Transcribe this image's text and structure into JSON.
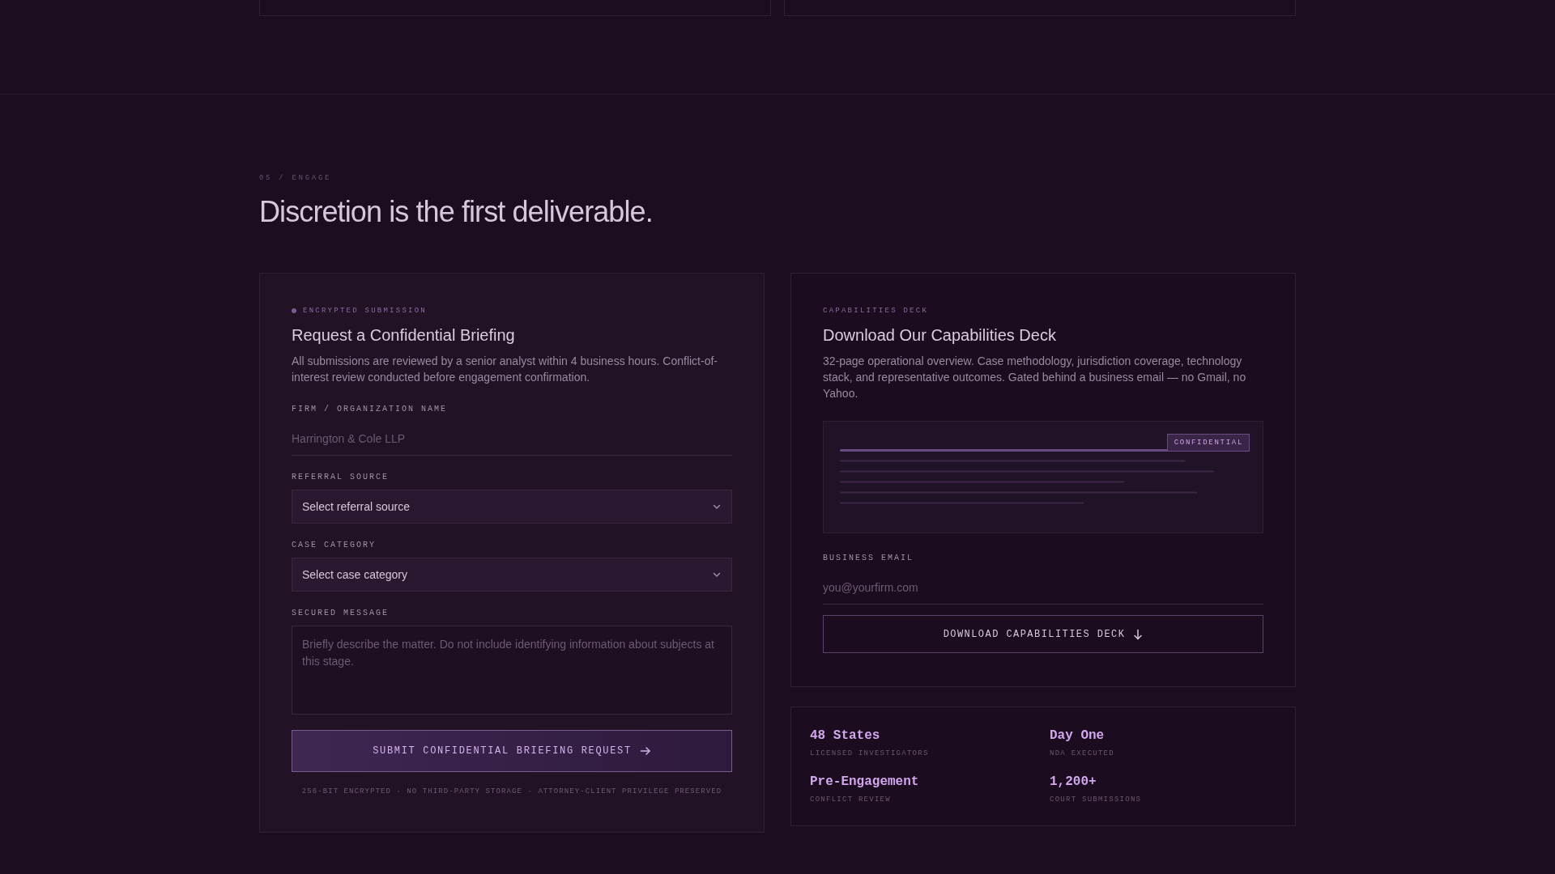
{
  "section": {
    "eyebrow": "05 / ENGAGE",
    "heading": "Discretion is the first deliverable."
  },
  "briefing_form": {
    "eyebrow": "ENCRYPTED SUBMISSION",
    "title": "Request a Confidential Briefing",
    "description": "All submissions are reviewed by a senior analyst within 4 business hours. Conflict-of-interest review conducted before engagement confirmation.",
    "fields": [
      {
        "kind": "text",
        "label": "FIRM / ORGANIZATION NAME",
        "placeholder": "Harrington & Cole LLP"
      },
      {
        "kind": "select",
        "label": "REFERRAL SOURCE",
        "value": "Select referral source"
      },
      {
        "kind": "select",
        "label": "CASE CATEGORY",
        "value": "Select case category"
      },
      {
        "kind": "textarea",
        "label": "SECURED MESSAGE",
        "placeholder": "Briefly describe the matter. Do not include identifying information about subjects at this stage."
      }
    ],
    "submit_button": "SUBMIT CONFIDENTIAL BRIEFING REQUEST",
    "footnote": "256-BIT ENCRYPTED · NO THIRD-PARTY STORAGE · ATTORNEY-CLIENT PRIVILEGE PRESERVED"
  },
  "capabilities_deck": {
    "eyebrow": "CAPABILITIES DECK",
    "title": "Download Our Capabilities Deck",
    "description": "32-page operational overview. Case methodology, jurisdiction coverage, technology stack, and representative outcomes. Gated behind a business email — no Gmail, no Yahoo.",
    "preview_badge": "CONFIDENTIAL",
    "email_field": {
      "label": "BUSINESS EMAIL",
      "placeholder": "you@yourfirm.com"
    },
    "download_button": "DOWNLOAD CAPABILITIES DECK"
  },
  "stats": [
    {
      "value": "48 States",
      "label": "LICENSED INVESTIGATORS"
    },
    {
      "value": "Day One",
      "label": "NDA EXECUTED"
    },
    {
      "value": "Pre-Engagement",
      "label": "CONFLICT REVIEW"
    },
    {
      "value": "1,200+",
      "label": "COURT SUBMISSIONS"
    }
  ]
}
